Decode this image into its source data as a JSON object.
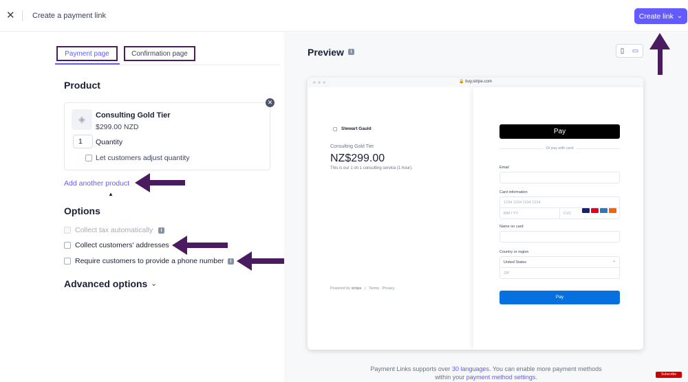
{
  "topbar": {
    "close_icon": "close-icon",
    "title": "Create a payment link",
    "create_label": "Create link"
  },
  "tabs": [
    {
      "label": "Payment page",
      "active": true
    },
    {
      "label": "Confirmation page",
      "active": false
    }
  ],
  "product": {
    "heading": "Product",
    "name": "Consulting Gold Tier",
    "price": "$299.00 NZD",
    "quantity_value": "1",
    "quantity_label": "Quantity",
    "adjust_label": "Let customers adjust quantity",
    "add_link": "Add another product"
  },
  "options": {
    "heading": "Options",
    "items": [
      {
        "label": "Collect tax automatically",
        "disabled": true
      },
      {
        "label": "Collect customers' addresses",
        "disabled": false
      },
      {
        "label": "Require customers to provide a phone number",
        "disabled": false
      }
    ]
  },
  "advanced": {
    "label": "Advanced options"
  },
  "preview": {
    "title": "Preview",
    "url": "buy.stripe.com",
    "merchant": "Stewart Gauld",
    "product_name": "Consulting Gold Tier",
    "price": "NZ$299.00",
    "description": "This is our 1 on 1 consulting service (1 hour).",
    "powered_by": "Powered by",
    "stripe_word": "stripe",
    "terms": "Terms",
    "privacy": "Privacy",
    "apple_pay": "Pay",
    "or_pay": "Or pay with card",
    "email_label": "Email",
    "card_label": "Card information",
    "card_placeholder": "1234 1234 1234 1234",
    "expiry_placeholder": "MM / YY",
    "cvc_placeholder": "CVC",
    "name_label": "Name on card",
    "country_label": "Country or region",
    "country_value": "United States",
    "zip_placeholder": "ZIP",
    "pay_label": "Pay"
  },
  "footer": {
    "text1": "Payment Links supports over ",
    "link1": "30 languages",
    "text2": ". You can enable more payment methods",
    "text3": "within your ",
    "link2": "payment method settings",
    "text4": "."
  },
  "badge": "Subscribe",
  "colors": {
    "accent": "#635bff",
    "annotation": "#4a1b5e",
    "pay": "#0570de"
  }
}
